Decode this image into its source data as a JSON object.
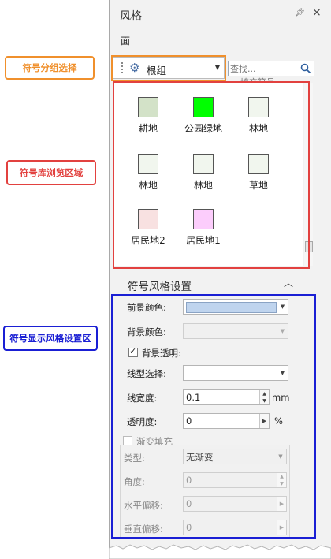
{
  "callouts": {
    "group_select": "符号分组选择",
    "library_browse": "符号库浏览区域",
    "style_settings": "符号显示风格设置区"
  },
  "colors": {
    "orange": "#f0902c",
    "red": "#e2413f",
    "blue": "#1a1fd4"
  },
  "panel": {
    "title": "风格",
    "pin_icon": "pin-icon",
    "close_icon": "close-icon",
    "tab": "面"
  },
  "group_combo": {
    "icon": "gear-icon",
    "value": "根组"
  },
  "search": {
    "placeholder": "查找..."
  },
  "truncated_label": "填充符号",
  "symbols": [
    {
      "name": "耕地",
      "color": "#d3e2c8"
    },
    {
      "name": "公园绿地",
      "color": "#00ff00"
    },
    {
      "name": "林地",
      "color": "#f1f6ee"
    },
    {
      "name": "林地",
      "color": "#f1f6ee"
    },
    {
      "name": "林地",
      "color": "#f1f6ee"
    },
    {
      "name": "草地",
      "color": "#f1f6ee"
    },
    {
      "name": "居民地2",
      "color": "#f8e1e1"
    },
    {
      "name": "居民地1",
      "color": "#fccdfc"
    }
  ],
  "settings": {
    "section_title": "符号风格设置",
    "foreground_label": "前景颜色:",
    "foreground_color": "#bfd4ee",
    "background_label": "背景颜色:",
    "bg_transparent_label": "背景透明:",
    "bg_transparent_checked": true,
    "line_type_label": "线型选择:",
    "line_width_label": "线宽度:",
    "line_width_value": "0.1",
    "line_width_unit": "mm",
    "opacity_label": "透明度:",
    "opacity_value": "0",
    "opacity_unit": "%",
    "gradient_label": "渐变填充",
    "gradient_checked": false,
    "type_label": "类型:",
    "type_value": "无渐变",
    "angle_label": "角度:",
    "angle_value": "0",
    "h_offset_label": "水平偏移:",
    "h_offset_value": "0",
    "v_offset_label": "垂直偏移:",
    "v_offset_value": "0"
  }
}
